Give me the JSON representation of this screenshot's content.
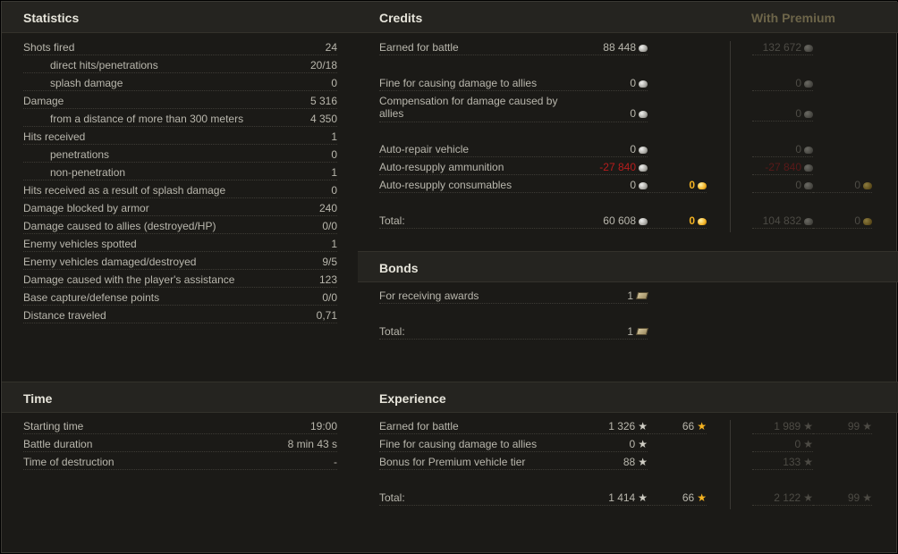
{
  "statistics": {
    "title": "Statistics",
    "rows": [
      {
        "label": "Shots fired",
        "value": "24",
        "indent": false
      },
      {
        "label": "direct hits/penetrations",
        "value": "20/18",
        "indent": true
      },
      {
        "label": "splash damage",
        "value": "0",
        "indent": true
      },
      {
        "label": "Damage",
        "value": "5 316",
        "indent": false
      },
      {
        "label": "from a distance of more than 300 meters",
        "value": "4 350",
        "indent": true
      },
      {
        "label": "Hits received",
        "value": "1",
        "indent": false
      },
      {
        "label": "penetrations",
        "value": "0",
        "indent": true
      },
      {
        "label": "non-penetration",
        "value": "1",
        "indent": true
      },
      {
        "label": "Hits received as a result of splash damage",
        "value": "0",
        "indent": false
      },
      {
        "label": "Damage blocked by armor",
        "value": "240",
        "indent": false
      },
      {
        "label": "Damage caused to allies (destroyed/HP)",
        "value": "0/0",
        "indent": false
      },
      {
        "label": "Enemy vehicles spotted",
        "value": "1",
        "indent": false
      },
      {
        "label": "Enemy vehicles damaged/destroyed",
        "value": "9/5",
        "indent": false
      },
      {
        "label": "Damage caused with the player's assistance",
        "value": "123",
        "indent": false
      },
      {
        "label": "Base capture/defense points",
        "value": "0/0",
        "indent": false
      },
      {
        "label": "Distance traveled",
        "value": "0,71",
        "indent": false
      }
    ]
  },
  "credits": {
    "title": "Credits",
    "premium_title": "With Premium",
    "rows": {
      "earned": {
        "label": "Earned for battle",
        "value": "88 448",
        "premium": "132 672"
      },
      "fine": {
        "label": "Fine for causing damage to allies",
        "value": "0",
        "premium": "0"
      },
      "compensation": {
        "label_line1": "Compensation for damage caused by",
        "label_line2": "allies",
        "value": "0",
        "premium": "0"
      },
      "repair": {
        "label": "Auto-repair vehicle",
        "value": "0",
        "premium": "0"
      },
      "ammo": {
        "label": "Auto-resupply ammunition",
        "value": "-27 840",
        "premium": "-27 840"
      },
      "consumables": {
        "label": "Auto-resupply consumables",
        "value": "0",
        "gold": "0",
        "premium": "0",
        "premium_gold": "0"
      },
      "total": {
        "label": "Total:",
        "value": "60 608",
        "gold": "0",
        "premium": "104 832",
        "premium_gold": "0"
      }
    }
  },
  "bonds": {
    "title": "Bonds",
    "rows": {
      "awards": {
        "label": "For receiving awards",
        "value": "1"
      },
      "total": {
        "label": "Total:",
        "value": "1"
      }
    }
  },
  "time": {
    "title": "Time",
    "rows": [
      {
        "label": "Starting time",
        "value": "19:00"
      },
      {
        "label": "Battle duration",
        "value": "8 min 43 s"
      },
      {
        "label": "Time of destruction",
        "value": "-"
      }
    ]
  },
  "experience": {
    "title": "Experience",
    "rows": {
      "earned": {
        "label": "Earned for battle",
        "value": "1 326",
        "free": "66",
        "premium": "1 989",
        "premium_free": "99"
      },
      "fine": {
        "label": "Fine for causing damage to allies",
        "value": "0",
        "premium": "0"
      },
      "bonus": {
        "label": "Bonus for Premium vehicle tier",
        "value": "88",
        "premium": "133"
      },
      "total": {
        "label": "Total:",
        "value": "1 414",
        "free": "66",
        "premium": "2 122",
        "premium_free": "99"
      }
    }
  },
  "icons": {
    "credits": "silver-coin-icon",
    "gold": "gold-coin-icon",
    "xp": "star-icon",
    "free_xp": "gold-star-icon",
    "bonds": "bond-icon"
  },
  "colors": {
    "background": "#1b1a17",
    "header": "#252420",
    "negative": "#b81d1d",
    "gold": "#f5b321",
    "premium_title": "#6d6549"
  }
}
